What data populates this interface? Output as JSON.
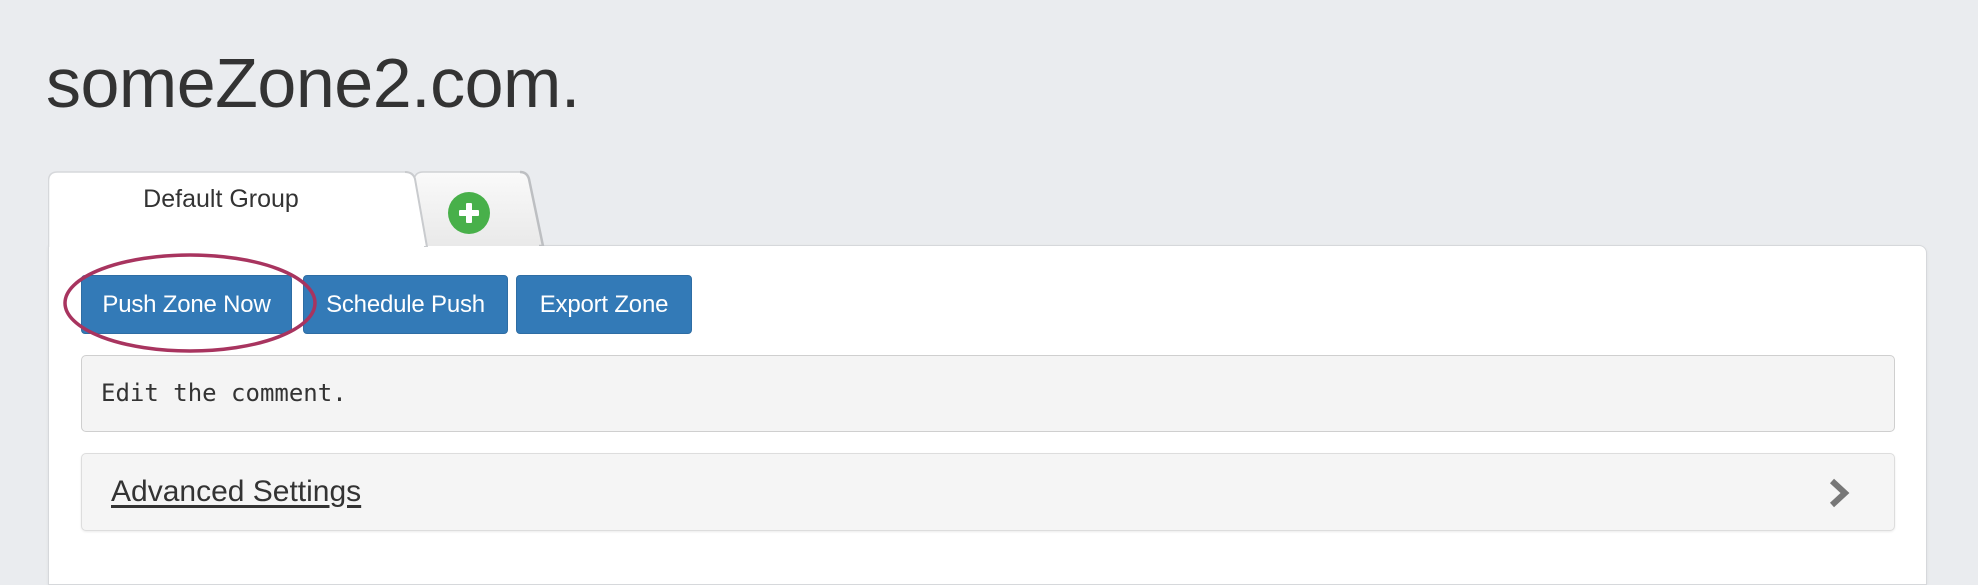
{
  "page": {
    "title": "someZone2.com."
  },
  "tabs": {
    "active_label": "Default Group",
    "add_icon": "plus-circle-icon",
    "add_color": "#48b04a"
  },
  "toolbar": {
    "push_label": "Push Zone Now",
    "schedule_label": "Schedule Push",
    "export_label": "Export Zone",
    "button_color": "#337ab7",
    "highlight_color": "#a8345f"
  },
  "comment": {
    "value": "Edit the comment."
  },
  "advanced": {
    "label": "Advanced Settings",
    "icon": "chevron-right-icon"
  }
}
